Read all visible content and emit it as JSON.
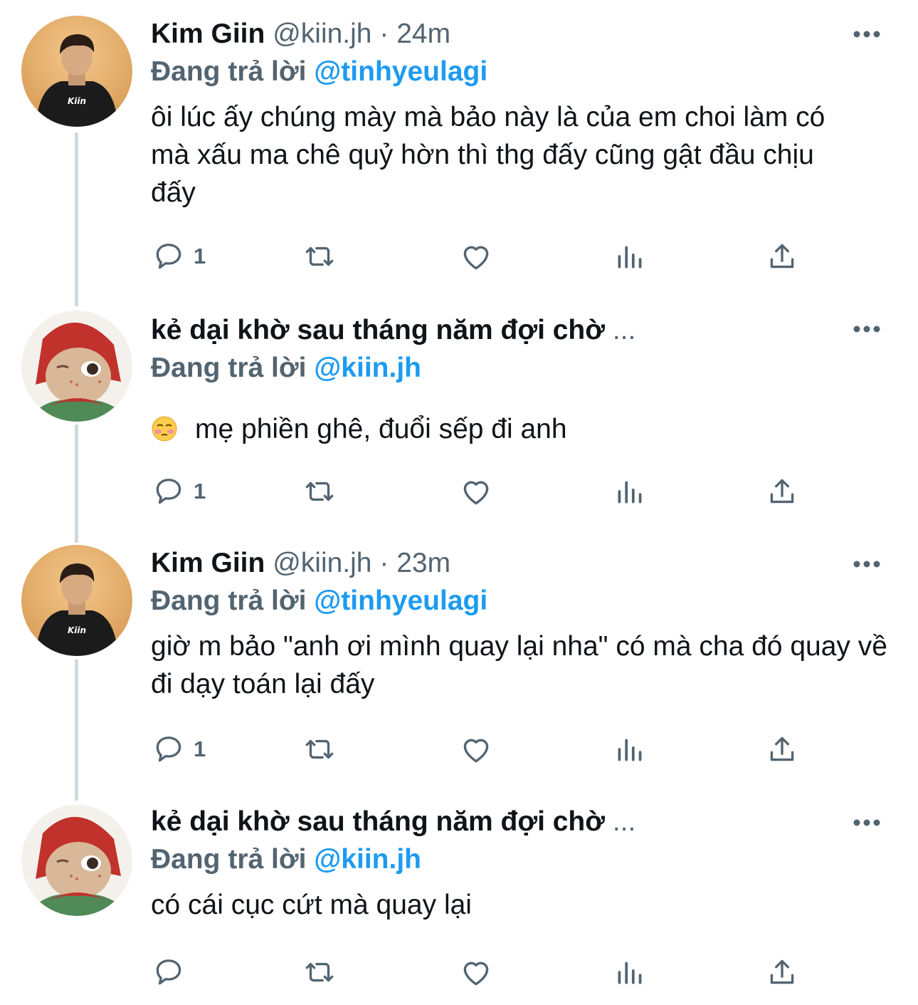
{
  "tweets": [
    {
      "name": "Kim Giin",
      "handle": "@kiin.jh",
      "separator": "·",
      "time": "24m",
      "replying_prefix": "Đang trả lời",
      "replying_to": "@tinhyeulagi",
      "text": "ôi lúc ấy chúng mày mà bảo này là của em choi làm có mà xấu ma chê quỷ hờn thì thg đấy cũng gật đầu chịu đấy",
      "reply_count": "1",
      "avatar": "avatar-kim-giin"
    },
    {
      "name": "kẻ dại khờ sau tháng năm đợi chờ",
      "name_truncation": "...",
      "replying_prefix": "Đang trả lời",
      "replying_to": "@kiin.jh",
      "emoji": "flushed-face-emoji",
      "text": "mẹ phiền ghê, đuổi sếp đi anh",
      "reply_count": "1",
      "avatar": "avatar-doll"
    },
    {
      "name": "Kim Giin",
      "handle": "@kiin.jh",
      "separator": "·",
      "time": "23m",
      "replying_prefix": "Đang trả lời",
      "replying_to": "@tinhyeulagi",
      "text": "giờ m bảo \"anh ơi mình quay lại nha\" có mà cha đó quay về đi dạy toán lại đấy",
      "reply_count": "1",
      "avatar": "avatar-kim-giin"
    },
    {
      "name": "kẻ dại khờ sau tháng năm đợi chờ",
      "name_truncation": "...",
      "replying_prefix": "Đang trả lời",
      "replying_to": "@kiin.jh",
      "text": "có cái cục cứt mà quay lại",
      "reply_count": "",
      "avatar": "avatar-doll"
    }
  ],
  "icons": {
    "reply": "reply-icon",
    "retweet": "retweet-icon",
    "like": "like-icon",
    "views": "views-icon",
    "share": "share-icon",
    "more": "more-icon"
  },
  "colors": {
    "text": "#0f1419",
    "secondary": "#536471",
    "link": "#1d9bf0",
    "thread_line": "#cfd9de"
  }
}
